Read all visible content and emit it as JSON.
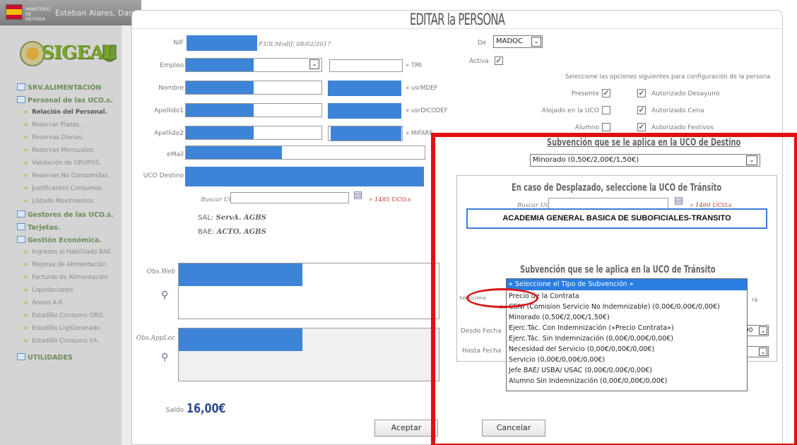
{
  "app": {
    "user": "Esteban Alares, Dan",
    "ministry": "MINISTERIO DE DEFENSA",
    "logo": "SIGEAL"
  },
  "sidebar": {
    "cat1": "SRV.ALIMENTACIÓN",
    "cat2": "Personal de las UCO.s.",
    "items": [
      "Relación del Personal.",
      "Reservar Plazas.",
      "Reservas Diarias.",
      "Reservas Mensuales.",
      "Validación de GRUPOS.",
      "Reservas No Consumidas.",
      "Justificantes Consumos.",
      "Listado Movimientos"
    ],
    "cat3": "Gestores de las UCO.s.",
    "cat4": "Tarjetas.",
    "cat5": "Gestión Económica.",
    "items2": [
      "Ingresos al Habilitado BAE.",
      "Mejoras de Alimentación.",
      "Facturas de Alimentación",
      "Liquidaciones",
      "Anexo A-6",
      "Estadillo Consumo ORG.",
      "Estadillo Liq/Generado.",
      "Estadillo Consumo I/A."
    ],
    "cat6": "UTILIDADES"
  },
  "dialog": {
    "title": "EDITAR la PERSONA",
    "nif": "NIF",
    "fecha": "F.Ult.Modif. 08/02/2017",
    "empleo": "Empleo",
    "nombre": "Nombre",
    "apellido1": "Apellido1",
    "apellido2": "Apellido2",
    "email": "eMail",
    "uco": "UCO Destino",
    "tmi": "« TMI",
    "usrmdef": "« usrMDEF",
    "usrdicodef": "« usrDICODEF",
    "mifare": "« MIFARE",
    "de": "De",
    "de_value": "MADOC",
    "activa": "Activa",
    "opts_heading": "Seleccione las opciones siguientes para configuración de la persona",
    "presente": "Presente",
    "alojado": "Alojado en la UCO",
    "alumno": "Alumno",
    "desayuno": "Autorizado Desayuno",
    "cena": "Autorizado Cena",
    "festivos": "Autorizado Festivos",
    "buscar": "Buscar UCO",
    "n_ucos": "» 1485 UCO.s",
    "sal_label": "SAL:",
    "sal": "ServA. AGBS",
    "bae_label": "BAE:",
    "bae": "ACTO. AGBS",
    "obsweb": "Obs.Web",
    "obsapp": "Obs.AppLoc",
    "saldo": "Saldo",
    "saldo_value": "16,00€",
    "aceptar": "Aceptar",
    "cancelar": "Cancelar",
    "subv_destino": "Subvención que se le aplica en la UCO de Destino",
    "subv_destino_value": "Minorado (0,50€/2,00€/1,50€)",
    "desplazado": "En caso de Desplazado, seleccione la UCO de Tránsito",
    "buscar2": "Buscar UCO",
    "n_ucos2": "» 1460 UCO.s",
    "academia": "ACADEMIA GENERAL BASICA DE SUBOFICIALES-TRANSITO",
    "subv_transito": "Subvención que se le aplica en la UCO de Tránsito",
    "desde": "Desde Fecha",
    "hasta": "Hasta Fecha",
    "sel_frag": "Selecciona",
    "de_frag": "de",
    "ra_frag": "rá",
    "h00": "00"
  },
  "dropdown": {
    "options": [
      "« Seleccione el Tipo de Subvención »",
      "Precio de la Contrata",
      "CSNI (Comision Servicio No Indemnizable) (0,00€/0,00€/0,00€)",
      "Minorado (0,50€/2,00€/1,50€)",
      "Ejerc.Tác. Con Indemnización («Precio Contrata»)",
      "Ejerc.Tác. Sin Indemnización (0,00€/0,00€/0,00€)",
      "Necesidad del Servicio (0,00€/0,00€/0,00€)",
      "Servicio (0,00€/0,00€/0,00€)",
      "Jefe BAE/ USBA/ USAC (0,00€/0,00€/0,00€)",
      "Alumno Sin Indemnización (0,00€/0,00€/0,00€)"
    ]
  },
  "colors": {
    "field_fill": "#3d84d8",
    "highlight": "#e01010",
    "selected": "#2a7de1"
  }
}
